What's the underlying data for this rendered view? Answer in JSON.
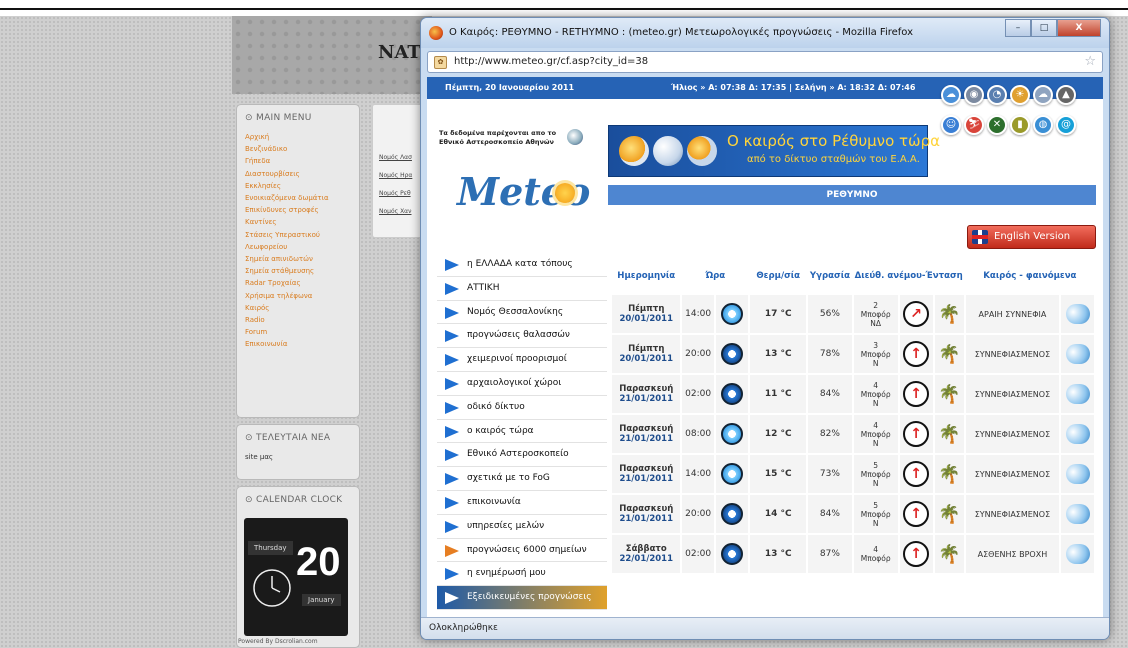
{
  "background_page": {
    "title": "NAT",
    "main_menu": {
      "heading": "MAIN MENU",
      "items": [
        "Αρχική",
        "Βενζινάδικο",
        "Γήπεδα",
        "Διαστουρβίσεις",
        "Εκκλησίες",
        "Ενοικιαζόμενα δωμάτια",
        "Επικίνδυνες στροφές",
        "Καντίνες",
        "Στάσεις Υπεραστικού Λεωφορείου",
        "Σημεία απινιδωτών",
        "Σημεία στάθμευσης",
        "Radar Τροχαίας",
        "Χρήσιμα τηλέφωνα",
        "Καιρός",
        "Radio",
        "Forum",
        "Επικοινωνία"
      ]
    },
    "links": [
      "Νομός Λασ",
      "Νομός Ηρα",
      "Νομός Ρεθ",
      "Νομός Χαν"
    ],
    "latest_news": {
      "heading": "ΤΕΛΕΥΤΑΙΑ ΝΕΑ",
      "text": "site μας"
    },
    "calendar": {
      "heading": "CALENDAR CLOCK",
      "day": "Thursday",
      "date": "20",
      "month": "January",
      "powered": "Powered By Dscrolian.com"
    }
  },
  "window": {
    "title": "Ο Καιρός: ΡΕΘΥΜΝΟ - RETHYMNO : (meteo.gr) Μετεωρολογικές προγνώσεις - Mozilla Firefox",
    "controls": {
      "minimize": "–",
      "maximize": "□",
      "close": "X"
    },
    "url": "http://www.meteo.gr/cf.asp?city_id=38",
    "status": "Ολοκληρώθηκε"
  },
  "site": {
    "date": "Πέμπτη, 20 Ιανουαρίου 2011",
    "sun_moon": "Ήλιος » Α: 07:38  Δ: 17:35  |  Σελήνη » Α: 18:32  Δ: 07:46",
    "source_text": "Τα δεδομένα παρέχονται απο το Εθνικό Αστεροσκοπείο Αθηνών",
    "logo": "Meteo",
    "banner_title": "Ο καιρός στο Ρέθυμνο τώρα",
    "banner_subtitle": "από το δίκτυο σταθμών του Ε.Α.Α.",
    "city": "ΡΕΘΥΜΝΟ",
    "english_version": "English Version",
    "nav": [
      "η ΕΛΛΑΔΑ κατα τόπους",
      "ΑΤΤΙΚΗ",
      "Νομός Θεσσαλονίκης",
      "προγνώσεις θαλασσών",
      "χειμερινοί προορισμοί",
      "αρχαιολογικοί χώροι",
      "οδικό δίκτυο",
      "ο καιρός τώρα",
      "Εθνικό Αστεροσκοπείο",
      "σχετικά με το FoG",
      "επικοινωνία",
      "υπηρεσίες μελών",
      "προγνώσεις 6000 σημείων",
      "η ενημέρωσή μου",
      "Εξειδικευμένες προγνώσεις"
    ],
    "table": {
      "headers": {
        "date": "Ημερομηνία",
        "time": "Ώρα",
        "temp": "Θερμ/σία",
        "humidity": "Υγρασία",
        "wind": "Διεύθ. ανέμου-Ένταση",
        "weather": "Καιρός - φαινόμενα"
      },
      "rows": [
        {
          "day": "Πέμπτη",
          "date": "20/01/2011",
          "time": "14:00",
          "temp": "17 °C",
          "hum": "56%",
          "wind_n": "2",
          "wind_u": "Μποφόρ",
          "wind_d": "ΝΔ",
          "cond": "ΑΡΑΙΗ ΣΥΝΝΕΦΙΑ",
          "clock": "day"
        },
        {
          "day": "Πέμπτη",
          "date": "20/01/2011",
          "time": "20:00",
          "temp": "13 °C",
          "hum": "78%",
          "wind_n": "3",
          "wind_u": "Μποφόρ",
          "wind_d": "Ν",
          "cond": "ΣΥΝΝΕΦΙΑΣΜΕΝΟΣ",
          "clock": "night"
        },
        {
          "day": "Παρασκευή",
          "date": "21/01/2011",
          "time": "02:00",
          "temp": "11 °C",
          "hum": "84%",
          "wind_n": "4",
          "wind_u": "Μποφόρ",
          "wind_d": "Ν",
          "cond": "ΣΥΝΝΕΦΙΑΣΜΕΝΟΣ",
          "clock": "night"
        },
        {
          "day": "Παρασκευή",
          "date": "21/01/2011",
          "time": "08:00",
          "temp": "12 °C",
          "hum": "82%",
          "wind_n": "4",
          "wind_u": "Μποφόρ",
          "wind_d": "Ν",
          "cond": "ΣΥΝΝΕΦΙΑΣΜΕΝΟΣ",
          "clock": "day"
        },
        {
          "day": "Παρασκευή",
          "date": "21/01/2011",
          "time": "14:00",
          "temp": "15 °C",
          "hum": "73%",
          "wind_n": "5",
          "wind_u": "Μποφόρ",
          "wind_d": "Ν",
          "cond": "ΣΥΝΝΕΦΙΑΣΜΕΝΟΣ",
          "clock": "day"
        },
        {
          "day": "Παρασκευή",
          "date": "21/01/2011",
          "time": "20:00",
          "temp": "14 °C",
          "hum": "84%",
          "wind_n": "5",
          "wind_u": "Μποφόρ",
          "wind_d": "Ν",
          "cond": "ΣΥΝΝΕΦΙΑΣΜΕΝΟΣ",
          "clock": "night"
        },
        {
          "day": "Σάββατο",
          "date": "22/01/2011",
          "time": "02:00",
          "temp": "13 °C",
          "hum": "87%",
          "wind_n": "4",
          "wind_u": "Μποφόρ",
          "wind_d": "",
          "cond": "ΑΣΘΕΝΗΣ ΒΡΟΧΗ",
          "clock": "night"
        }
      ]
    }
  },
  "colors": {
    "accent": "#2663b5",
    "date_orange": "#e39a2a",
    "banner_text": "#ffd43b",
    "english_btn": "#c02a1a"
  }
}
